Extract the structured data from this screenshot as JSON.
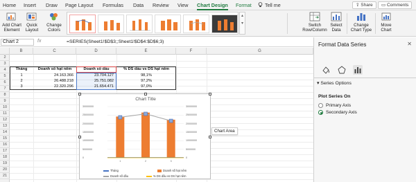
{
  "ribbon": {
    "tabs": [
      "Home",
      "Insert",
      "Draw",
      "Page Layout",
      "Formulas",
      "Data",
      "Review",
      "View",
      "Chart Design",
      "Format"
    ],
    "active_tab": "Chart Design",
    "tell_me": "Tell me",
    "share": "Share",
    "comments": "Comments",
    "buttons": {
      "add_chart_element": "Add Chart\nElement",
      "quick_layout": "Quick\nLayout",
      "change_colors": "Change\nColors",
      "switch_row_column": "Switch\nRow/Column",
      "select_data": "Select\nData",
      "change_chart_type": "Change\nChart Type",
      "move_chart": "Move\nChart"
    }
  },
  "formula_bar": {
    "name_box": "Chart 2",
    "fx": "fx",
    "formula": "=SERIES(Sheet1!$D$3;;Sheet1!$D$4:$D$6;3)"
  },
  "columns": [
    "B",
    "C",
    "D",
    "E",
    "F",
    "G"
  ],
  "rows": [
    "2",
    "3",
    "4",
    "5",
    "6",
    "7",
    "8",
    "9",
    "10",
    "11",
    "12",
    "13",
    "14",
    "15",
    "16",
    "17",
    "18",
    "19",
    "20",
    "21"
  ],
  "table": {
    "headers": [
      "Tháng",
      "Doanh số hạt nêm",
      "Doanh số dầu",
      "% DS dầu vs DS hạt nêm"
    ],
    "rows": [
      [
        "1",
        "24.163.366",
        "23.704.127",
        "98,1%"
      ],
      [
        "2",
        "26.488.218",
        "25.751.082",
        "97,2%"
      ],
      [
        "3",
        "22.320.296",
        "21.654.471",
        "97,0%"
      ]
    ]
  },
  "chart": {
    "title": "Chart Title",
    "tooltip": "Chart Area",
    "legend": [
      "Tháng",
      "Doanh số hạt nêm",
      "Doanh số dầu",
      "% DS dầu vs DS hạt nêm"
    ],
    "colors": {
      "thang": "#4472c4",
      "hat_nem": "#ed7d31",
      "dau": "#a5a5a5",
      "pct": "#ffc000"
    }
  },
  "chart_data": {
    "type": "bar",
    "categories": [
      "1",
      "2",
      "3"
    ],
    "series": [
      {
        "name": "Doanh số hạt nêm",
        "type": "bar",
        "values": [
          24163366,
          26488218,
          22320296
        ]
      },
      {
        "name": "Doanh số dầu",
        "type": "line",
        "values": [
          23704127,
          25751082,
          21654471
        ]
      }
    ],
    "left_axis_ticks": [
      "30000000",
      "25000000",
      "20000000",
      "15000000",
      "10000000",
      "5000000",
      "0"
    ],
    "right_axis_ticks": [
      "30000000",
      "25000000",
      "20000000",
      "15000000",
      "10000000",
      "5000000",
      "0"
    ],
    "ylim": [
      0,
      30000000
    ],
    "title": "Chart Title"
  },
  "pane": {
    "title": "Format Data Series",
    "section": "Series Options",
    "plot_on_label": "Plot Series On",
    "options": [
      "Primary Axis",
      "Secondary Axis"
    ],
    "selected_option": "Secondary Axis"
  }
}
